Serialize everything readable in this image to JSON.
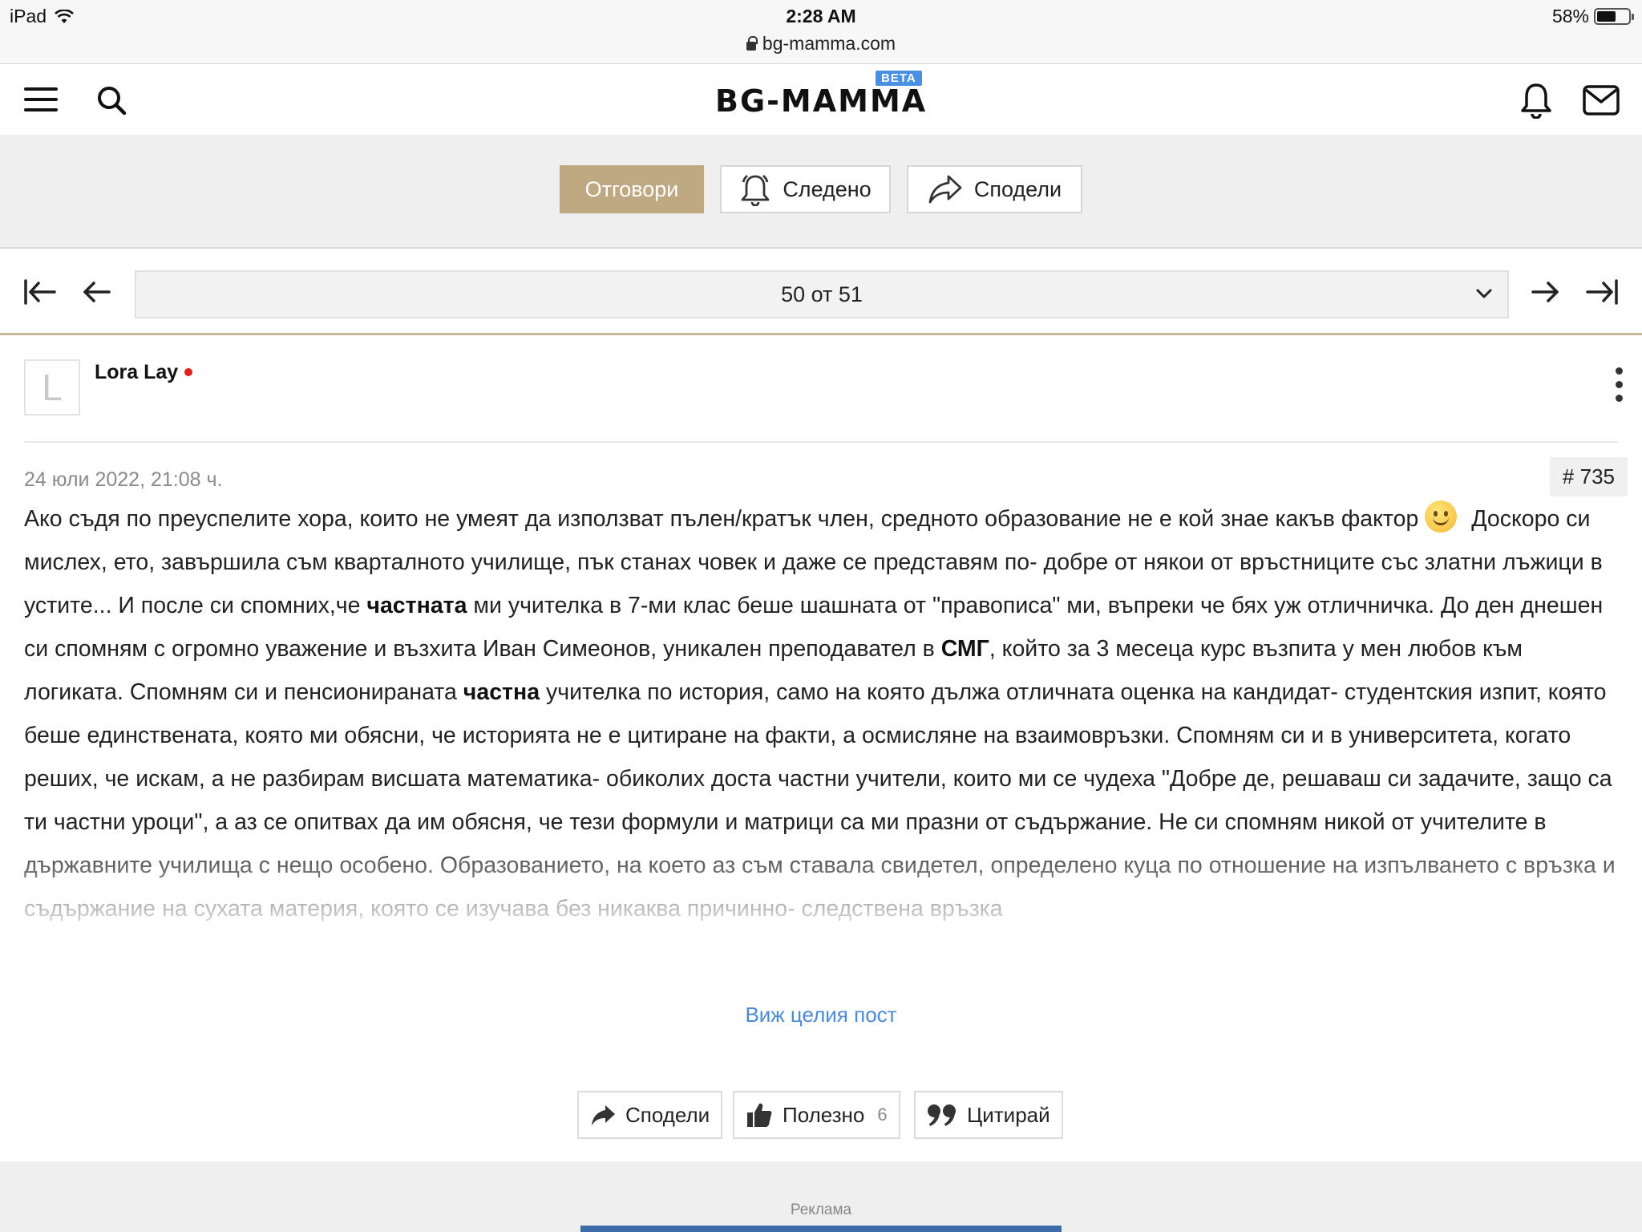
{
  "status_bar": {
    "device": "iPad",
    "time": "2:28 AM",
    "battery": "58%",
    "battery_level": 0.58,
    "url": "bg-mamma.com"
  },
  "header": {
    "logo": "BG-MAMMA",
    "badge": "BETA",
    "icons": [
      "menu-icon",
      "search-icon",
      "bell-icon",
      "mail-icon"
    ]
  },
  "actions": {
    "reply": "Отговори",
    "follow": "Следено",
    "share": "Сподели"
  },
  "pagination": {
    "label": "50 от 51"
  },
  "post": {
    "author": "Lora Lay",
    "avatar_letter": "L",
    "date": "24 юли 2022, 21:08 ч.",
    "number": "# 735",
    "body": [
      {
        "t": "Ако съдя по преуспелите хора, които не умеят да използват пълен/кратък член, средното образование не е кой знае какъв фактор "
      },
      {
        "emoji": "smiley"
      },
      {
        "t": "Доскоро си мислех, ето, завършила съм кварталното училище, пък станах човек и даже се представям по- добре от някои от връстниците със златни лъжици в устите... И после си спомних,че "
      },
      {
        "b": "частната"
      },
      {
        "t": " ми учителка в 7-ми клас беше шашната от \"правописа\" ми, въпреки че бях уж отличничка. До ден днешен си спомням с огромно уважение и възхита Иван Симеонов, уникален преподавател в "
      },
      {
        "b": "СМГ"
      },
      {
        "t": ", който за 3 месеца курс възпита у мен любов към логиката. Спомням си и пенсионираната "
      },
      {
        "b": "частна"
      },
      {
        "t": "  учителка по история, само на която дължа отличната оценка на кандидат- студентския изпит, която беше единствената, която ми обясни, че историята не е цитиране на факти, а осмисляне на взаимовръзки. Спомням си и в университета, когато реших, че искам, а не разбирам висшата математика- обиколих доста частни учители, които ми се чудеха \"Добре де, решаваш си задачите, защо са ти частни уроци\", а аз се опитвах да им обясня, че тези формули и матрици са ми празни от съдържание. Не си спомням никой от учителите в държавните училища с нещо особено. Образованието, на което аз съм ставала свидетел, определено куца по отношение на изпълването с връзка и съдържание на сухата материя, която се изучава без никаква причинно- следствена връзка"
      }
    ],
    "see_full": "Виж целия пост",
    "footer": {
      "share": "Сподели",
      "useful": "Полезно",
      "useful_count": "6",
      "quote": "Цитирай"
    }
  },
  "ad": {
    "label": "Реклама"
  }
}
